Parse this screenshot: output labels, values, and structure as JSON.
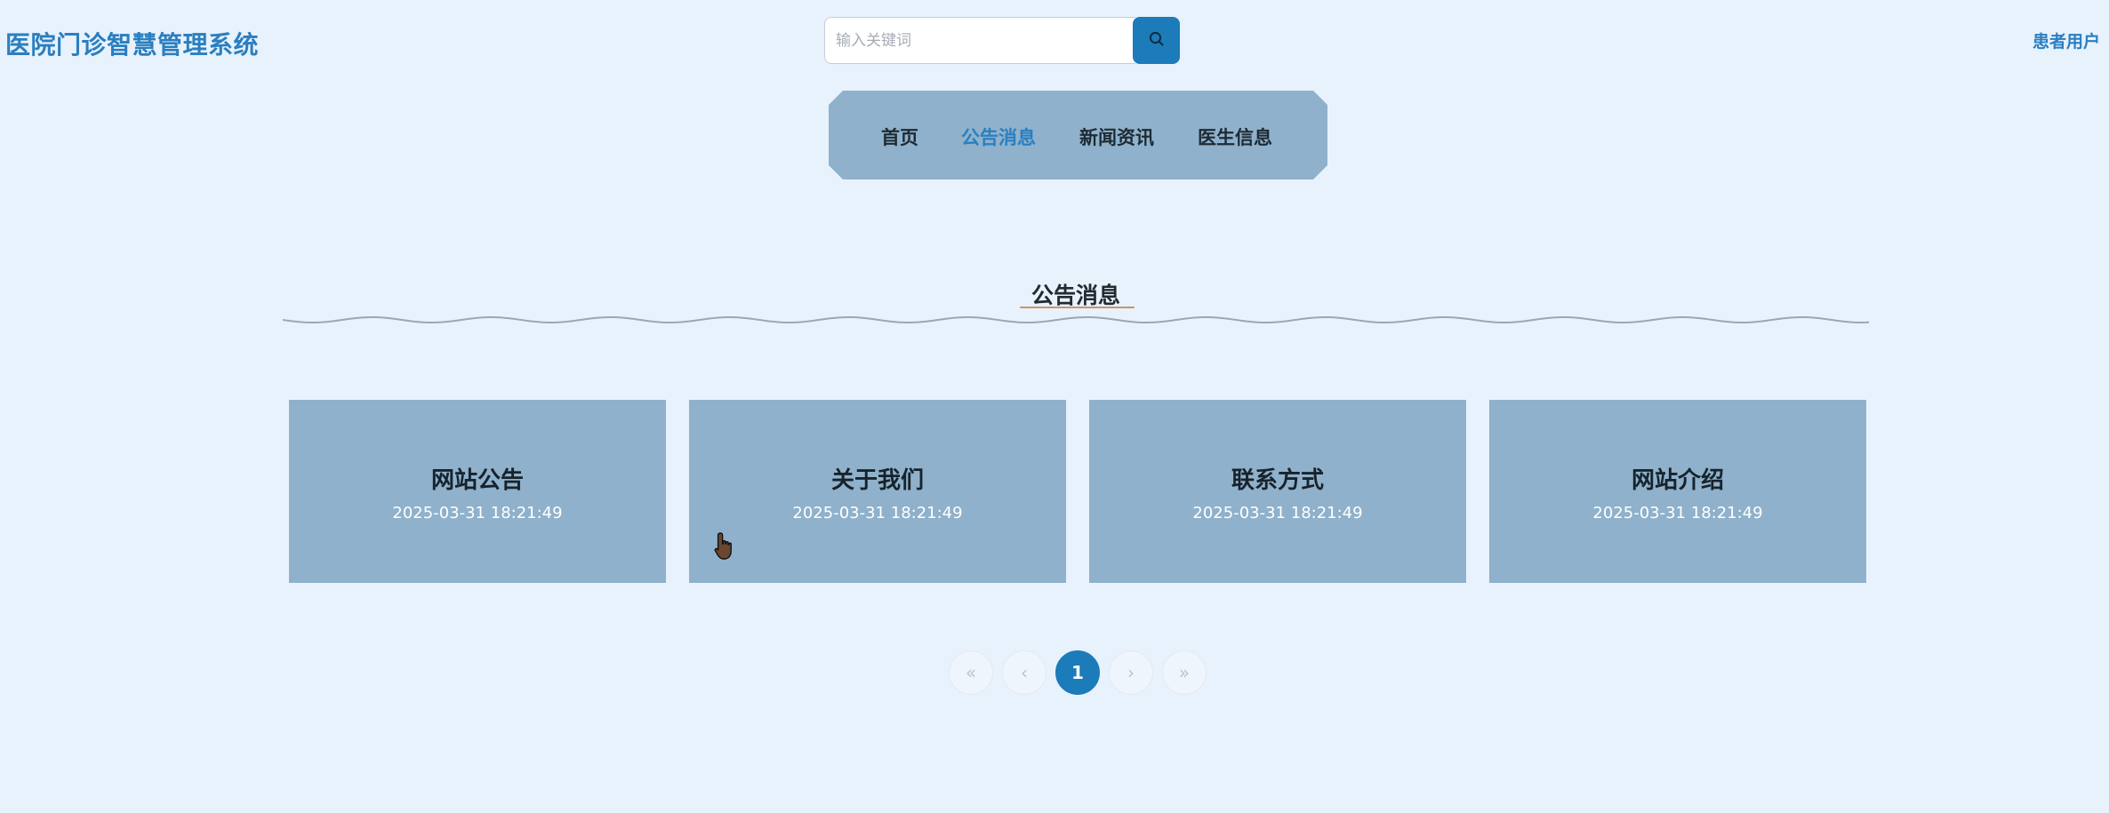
{
  "header": {
    "site_title": "医院门诊智慧管理系统",
    "search_placeholder": "输入关键词",
    "user_label": "患者用户"
  },
  "nav": {
    "items": [
      {
        "label": "首页",
        "active": false
      },
      {
        "label": "公告消息",
        "active": true
      },
      {
        "label": "新闻资讯",
        "active": false
      },
      {
        "label": "医生信息",
        "active": false
      }
    ]
  },
  "section": {
    "title": "公告消息"
  },
  "cards": [
    {
      "title": "网站公告",
      "date": "2025-03-31 18:21:49"
    },
    {
      "title": "关于我们",
      "date": "2025-03-31 18:21:49"
    },
    {
      "title": "联系方式",
      "date": "2025-03-31 18:21:49"
    },
    {
      "title": "网站介绍",
      "date": "2025-03-31 18:21:49"
    }
  ],
  "pagination": {
    "first": "«",
    "prev": "‹",
    "current": "1",
    "next": "›",
    "last": "»"
  },
  "colors": {
    "background": "#e8f2fd",
    "accent": "#1c7bb9",
    "title_blue": "#2a7fc0",
    "card": "#8fb1cb",
    "nav": "#8fb1cc"
  },
  "icons": {
    "search": "search-icon",
    "cursor": "hand-pointer-icon"
  }
}
